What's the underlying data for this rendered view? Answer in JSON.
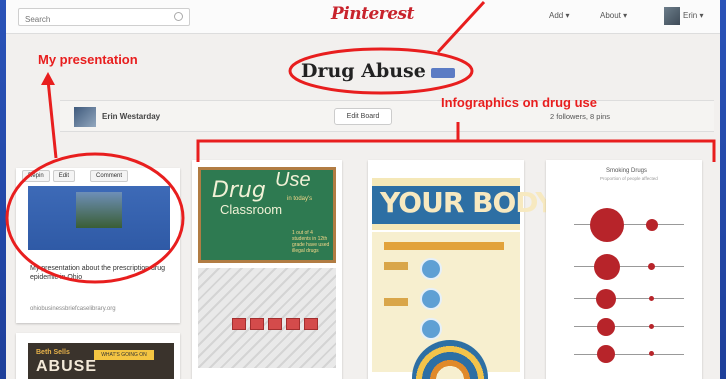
{
  "browser": {
    "search_placeholder": "Search",
    "logo_text": "Pinterest",
    "nav_add": "Add ▾",
    "nav_about": "About ▾",
    "nav_user": "Erin ▾"
  },
  "board": {
    "title": "Drug Abuse",
    "owner_name": "Erin Westarday",
    "edit_board_label": "Edit Board",
    "followers_text": "2 followers, 8 pins"
  },
  "pins": {
    "first": {
      "repin_label": "Repin",
      "edit_label": "Edit",
      "comment_label": "Comment",
      "description": "My presentation about the prescription drug epidemic in Ohio",
      "source": "ohiobusinessbriefcaselibrary.org"
    },
    "second_top": "Beth Sells",
    "second_title": "ABUSE",
    "second_badge": "WHAT'S GOING ON",
    "chalk": {
      "word1": "Drug",
      "word2": "Use",
      "word3": "Classroom",
      "small": "in today's",
      "note": "1 out of 4 students in 12th grade have used illegal drugs"
    },
    "body_title": "YOUR BODY",
    "smoking_title": "Smoking Drugs",
    "smoking_sub": "Proportion of people affected"
  },
  "annotations": {
    "my_presentation": "My presentation",
    "infographics": "Infographics on drug use"
  },
  "colors": {
    "slide_bg": "#2347a8",
    "annotation": "#e81e1e",
    "pinterest_red": "#c8232c"
  }
}
